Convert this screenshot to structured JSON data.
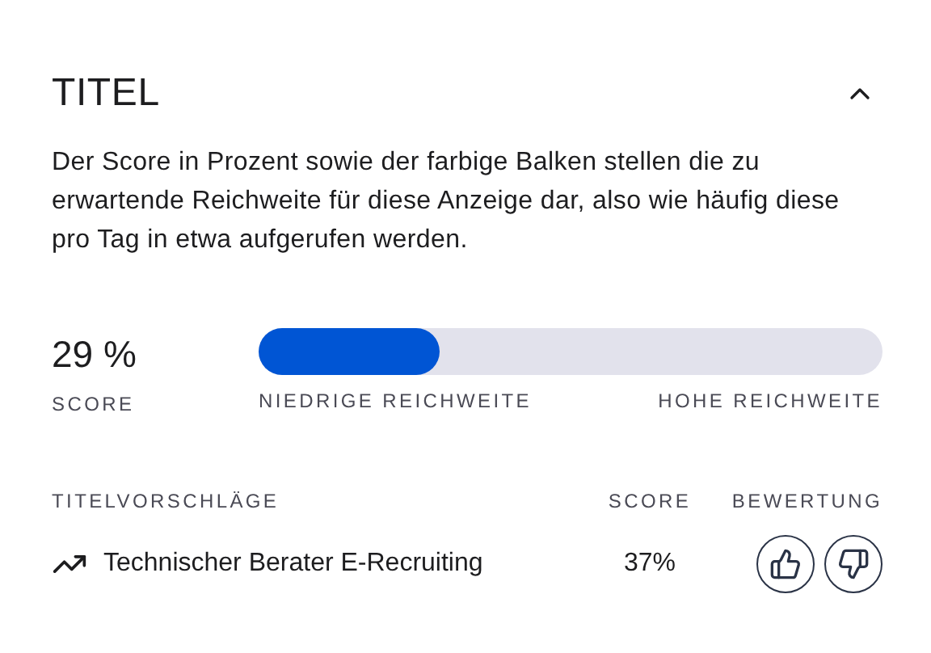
{
  "section": {
    "title": "TITEL",
    "expanded": true,
    "description": "Der Score in Prozent sowie der farbige Balken stellen die zu erwartende Reichweite für diese Anzeige dar, also wie häufig diese pro Tag in etwa aufgerufen werden."
  },
  "score": {
    "value": "29 %",
    "label": "SCORE",
    "level": 0.29,
    "low_label": "NIEDRIGE REICHWEITE",
    "high_label": "HOHE REICHWEITE"
  },
  "suggestions": {
    "columns": [
      "TITELVORSCHLÄGE",
      "SCORE",
      "BEWERTUNG"
    ],
    "rows": [
      {
        "title": "Technischer Berater E-Recruiting",
        "score": "37%"
      }
    ]
  }
}
